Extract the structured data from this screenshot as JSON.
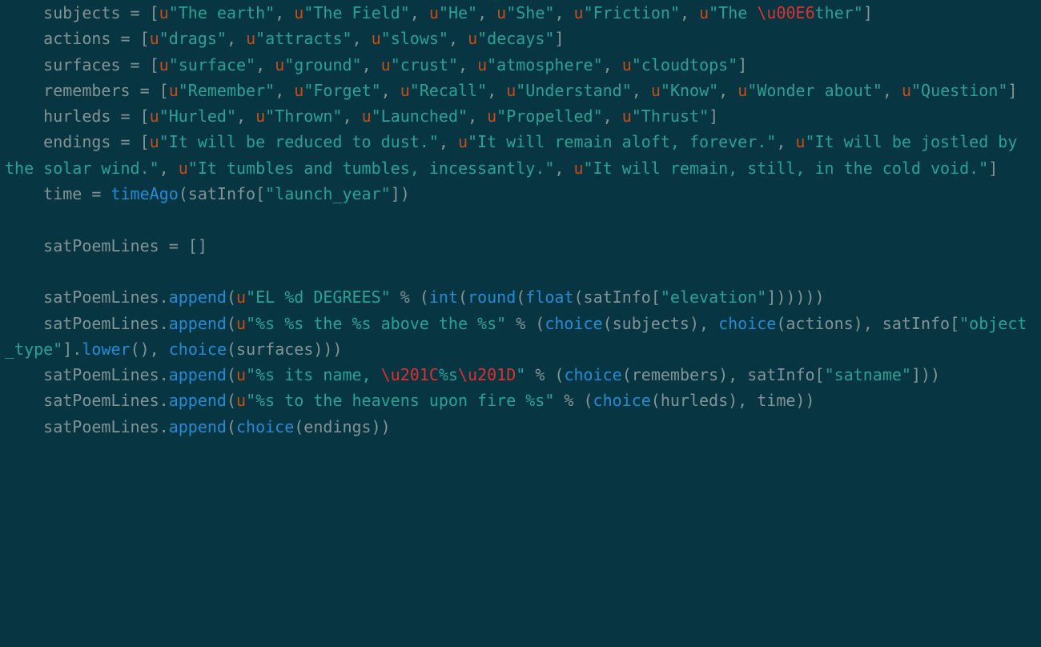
{
  "colors": {
    "background": "#073642",
    "default": "#839496",
    "string": "#2aa198",
    "string_prefix": "#cb4b16",
    "escape": "#dc322f",
    "builtin": "#268bd2"
  },
  "code_lines": [
    {
      "indent": 4,
      "segments": [
        {
          "t": "subjects = [",
          "c": "default"
        },
        {
          "t": "u",
          "c": "prefix"
        },
        {
          "t": "\"The earth\"",
          "c": "string"
        },
        {
          "t": ", ",
          "c": "default"
        },
        {
          "t": "u",
          "c": "prefix"
        },
        {
          "t": "\"The Field\"",
          "c": "string"
        },
        {
          "t": ", ",
          "c": "default"
        },
        {
          "t": "u",
          "c": "prefix"
        },
        {
          "t": "\"He\"",
          "c": "string"
        },
        {
          "t": ", ",
          "c": "default"
        },
        {
          "t": "u",
          "c": "prefix"
        },
        {
          "t": "\"She\"",
          "c": "string"
        },
        {
          "t": ", ",
          "c": "default"
        },
        {
          "t": "u",
          "c": "prefix"
        },
        {
          "t": "\"Friction\"",
          "c": "string"
        },
        {
          "t": ", ",
          "c": "default"
        },
        {
          "t": "u",
          "c": "prefix"
        },
        {
          "t": "\"The ",
          "c": "string"
        },
        {
          "t": "\\u00E6",
          "c": "escape"
        },
        {
          "t": "ther\"",
          "c": "string"
        },
        {
          "t": "]",
          "c": "default"
        }
      ]
    },
    {
      "indent": 4,
      "segments": [
        {
          "t": "actions = [",
          "c": "default"
        },
        {
          "t": "u",
          "c": "prefix"
        },
        {
          "t": "\"drags\"",
          "c": "string"
        },
        {
          "t": ", ",
          "c": "default"
        },
        {
          "t": "u",
          "c": "prefix"
        },
        {
          "t": "\"attracts\"",
          "c": "string"
        },
        {
          "t": ", ",
          "c": "default"
        },
        {
          "t": "u",
          "c": "prefix"
        },
        {
          "t": "\"slows\"",
          "c": "string"
        },
        {
          "t": ", ",
          "c": "default"
        },
        {
          "t": "u",
          "c": "prefix"
        },
        {
          "t": "\"decays\"",
          "c": "string"
        },
        {
          "t": "]",
          "c": "default"
        }
      ]
    },
    {
      "indent": 4,
      "segments": [
        {
          "t": "surfaces = [",
          "c": "default"
        },
        {
          "t": "u",
          "c": "prefix"
        },
        {
          "t": "\"surface\"",
          "c": "string"
        },
        {
          "t": ", ",
          "c": "default"
        },
        {
          "t": "u",
          "c": "prefix"
        },
        {
          "t": "\"ground\"",
          "c": "string"
        },
        {
          "t": ", ",
          "c": "default"
        },
        {
          "t": "u",
          "c": "prefix"
        },
        {
          "t": "\"crust\"",
          "c": "string"
        },
        {
          "t": ", ",
          "c": "default"
        },
        {
          "t": "u",
          "c": "prefix"
        },
        {
          "t": "\"atmosphere\"",
          "c": "string"
        },
        {
          "t": ", ",
          "c": "default"
        },
        {
          "t": "u",
          "c": "prefix"
        },
        {
          "t": "\"cloudtops\"",
          "c": "string"
        },
        {
          "t": "]",
          "c": "default"
        }
      ]
    },
    {
      "indent": 4,
      "segments": [
        {
          "t": "remembers = [",
          "c": "default"
        },
        {
          "t": "u",
          "c": "prefix"
        },
        {
          "t": "\"Remember\"",
          "c": "string"
        },
        {
          "t": ", ",
          "c": "default"
        },
        {
          "t": "u",
          "c": "prefix"
        },
        {
          "t": "\"Forget\"",
          "c": "string"
        },
        {
          "t": ", ",
          "c": "default"
        },
        {
          "t": "u",
          "c": "prefix"
        },
        {
          "t": "\"Recall\"",
          "c": "string"
        },
        {
          "t": ", ",
          "c": "default"
        },
        {
          "t": "u",
          "c": "prefix"
        },
        {
          "t": "\"Understand\"",
          "c": "string"
        },
        {
          "t": ", ",
          "c": "default"
        },
        {
          "t": "u",
          "c": "prefix"
        },
        {
          "t": "\"Know\"",
          "c": "string"
        },
        {
          "t": ", ",
          "c": "default"
        },
        {
          "t": "u",
          "c": "prefix"
        },
        {
          "t": "\"Wonder about\"",
          "c": "string"
        },
        {
          "t": ", ",
          "c": "default"
        },
        {
          "t": "u",
          "c": "prefix"
        },
        {
          "t": "\"Question\"",
          "c": "string"
        },
        {
          "t": "]",
          "c": "default"
        }
      ]
    },
    {
      "indent": 4,
      "segments": [
        {
          "t": "hurleds = [",
          "c": "default"
        },
        {
          "t": "u",
          "c": "prefix"
        },
        {
          "t": "\"Hurled\"",
          "c": "string"
        },
        {
          "t": ", ",
          "c": "default"
        },
        {
          "t": "u",
          "c": "prefix"
        },
        {
          "t": "\"Thrown\"",
          "c": "string"
        },
        {
          "t": ", ",
          "c": "default"
        },
        {
          "t": "u",
          "c": "prefix"
        },
        {
          "t": "\"Launched\"",
          "c": "string"
        },
        {
          "t": ", ",
          "c": "default"
        },
        {
          "t": "u",
          "c": "prefix"
        },
        {
          "t": "\"Propelled\"",
          "c": "string"
        },
        {
          "t": ", ",
          "c": "default"
        },
        {
          "t": "u",
          "c": "prefix"
        },
        {
          "t": "\"Thrust\"",
          "c": "string"
        },
        {
          "t": "]",
          "c": "default"
        }
      ]
    },
    {
      "indent": 4,
      "segments": [
        {
          "t": "endings = [",
          "c": "default"
        },
        {
          "t": "u",
          "c": "prefix"
        },
        {
          "t": "\"It will be reduced to dust.\"",
          "c": "string"
        },
        {
          "t": ", ",
          "c": "default"
        },
        {
          "t": "u",
          "c": "prefix"
        },
        {
          "t": "\"It will remain aloft, forever.\"",
          "c": "string"
        },
        {
          "t": ", ",
          "c": "default"
        },
        {
          "t": "u",
          "c": "prefix"
        },
        {
          "t": "\"It will be jostled by the solar wind.\"",
          "c": "string"
        },
        {
          "t": ", ",
          "c": "default"
        },
        {
          "t": "u",
          "c": "prefix"
        },
        {
          "t": "\"It tumbles and tumbles, incessantly.\"",
          "c": "string"
        },
        {
          "t": ", ",
          "c": "default"
        },
        {
          "t": "u",
          "c": "prefix"
        },
        {
          "t": "\"It will remain, still, in the cold void.\"",
          "c": "string"
        },
        {
          "t": "]",
          "c": "default"
        }
      ]
    },
    {
      "indent": 4,
      "segments": [
        {
          "t": "time = ",
          "c": "default"
        },
        {
          "t": "timeAgo",
          "c": "func"
        },
        {
          "t": "(satInfo[",
          "c": "default"
        },
        {
          "t": "\"launch_year\"",
          "c": "string"
        },
        {
          "t": "])",
          "c": "default"
        }
      ]
    },
    {
      "indent": 0,
      "segments": [
        {
          "t": "",
          "c": "default"
        }
      ]
    },
    {
      "indent": 4,
      "segments": [
        {
          "t": "satPoemLines = []",
          "c": "default"
        }
      ]
    },
    {
      "indent": 0,
      "segments": [
        {
          "t": "",
          "c": "default"
        }
      ]
    },
    {
      "indent": 4,
      "segments": [
        {
          "t": "satPoemLines.",
          "c": "default"
        },
        {
          "t": "append",
          "c": "func"
        },
        {
          "t": "(",
          "c": "default"
        },
        {
          "t": "u",
          "c": "prefix"
        },
        {
          "t": "\"EL %d DEGREES\"",
          "c": "string"
        },
        {
          "t": " % (",
          "c": "default"
        },
        {
          "t": "int",
          "c": "builtin"
        },
        {
          "t": "(",
          "c": "default"
        },
        {
          "t": "round",
          "c": "builtin"
        },
        {
          "t": "(",
          "c": "default"
        },
        {
          "t": "float",
          "c": "builtin"
        },
        {
          "t": "(satInfo[",
          "c": "default"
        },
        {
          "t": "\"elevation\"",
          "c": "string"
        },
        {
          "t": "])))))",
          "c": "default"
        }
      ]
    },
    {
      "indent": 4,
      "segments": [
        {
          "t": "satPoemLines.",
          "c": "default"
        },
        {
          "t": "append",
          "c": "func"
        },
        {
          "t": "(",
          "c": "default"
        },
        {
          "t": "u",
          "c": "prefix"
        },
        {
          "t": "\"%s %s the %s above the %s\"",
          "c": "string"
        },
        {
          "t": " % (",
          "c": "default"
        },
        {
          "t": "choice",
          "c": "func"
        },
        {
          "t": "(subjects), ",
          "c": "default"
        },
        {
          "t": "choice",
          "c": "func"
        },
        {
          "t": "(actions), satInfo[",
          "c": "default"
        },
        {
          "t": "\"object_type\"",
          "c": "string"
        },
        {
          "t": "].",
          "c": "default"
        },
        {
          "t": "lower",
          "c": "func"
        },
        {
          "t": "(), ",
          "c": "default"
        },
        {
          "t": "choice",
          "c": "func"
        },
        {
          "t": "(surfaces)))",
          "c": "default"
        }
      ]
    },
    {
      "indent": 4,
      "segments": [
        {
          "t": "satPoemLines.",
          "c": "default"
        },
        {
          "t": "append",
          "c": "func"
        },
        {
          "t": "(",
          "c": "default"
        },
        {
          "t": "u",
          "c": "prefix"
        },
        {
          "t": "\"%s its name, ",
          "c": "string"
        },
        {
          "t": "\\u201C",
          "c": "escape"
        },
        {
          "t": "%s",
          "c": "string"
        },
        {
          "t": "\\u201D",
          "c": "escape"
        },
        {
          "t": "\"",
          "c": "string"
        },
        {
          "t": " % (",
          "c": "default"
        },
        {
          "t": "choice",
          "c": "func"
        },
        {
          "t": "(remembers), satInfo[",
          "c": "default"
        },
        {
          "t": "\"satname\"",
          "c": "string"
        },
        {
          "t": "]))",
          "c": "default"
        }
      ]
    },
    {
      "indent": 4,
      "segments": [
        {
          "t": "satPoemLines.",
          "c": "default"
        },
        {
          "t": "append",
          "c": "func"
        },
        {
          "t": "(",
          "c": "default"
        },
        {
          "t": "u",
          "c": "prefix"
        },
        {
          "t": "\"%s to the heavens upon fire %s\"",
          "c": "string"
        },
        {
          "t": " % (",
          "c": "default"
        },
        {
          "t": "choice",
          "c": "func"
        },
        {
          "t": "(hurleds), time))",
          "c": "default"
        }
      ]
    },
    {
      "indent": 4,
      "segments": [
        {
          "t": "satPoemLines.",
          "c": "default"
        },
        {
          "t": "append",
          "c": "func"
        },
        {
          "t": "(",
          "c": "default"
        },
        {
          "t": "choice",
          "c": "func"
        },
        {
          "t": "(endings))",
          "c": "default"
        }
      ]
    }
  ]
}
